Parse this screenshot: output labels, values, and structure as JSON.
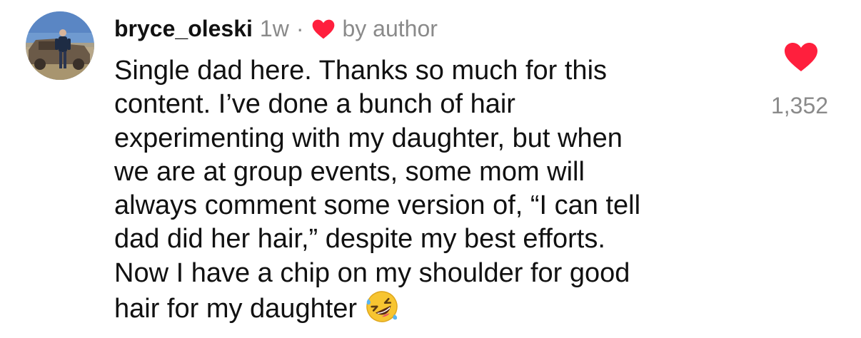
{
  "comment": {
    "username": "bryce_oleski",
    "timestamp": "1w",
    "separator": "·",
    "author_badge": "by author",
    "body_lines": [
      "Single dad here. Thanks so much for this",
      "content. I’ve done a bunch of hair",
      "experimenting with my daughter, but when",
      "we are at group events, some mom will",
      "always comment some version of, “I can tell",
      "dad did her hair,” despite my best efforts.",
      "Now I have a chip on my shoulder for good",
      "hair for my daughter"
    ],
    "emoji": "rolling-on-the-floor-laughing",
    "like_count": "1,352"
  },
  "colors": {
    "heart": "#ff1f3d",
    "text": "#111111",
    "secondary": "#8a8a8a"
  },
  "icons": {
    "author_like": "heart-icon",
    "like_button": "heart-filled-icon",
    "avatar": "avatar-photo"
  }
}
